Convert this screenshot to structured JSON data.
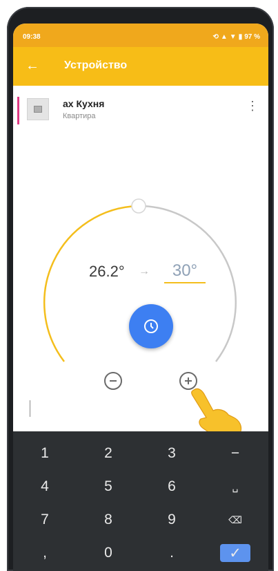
{
  "status_bar": {
    "time": "09:38",
    "battery": "97 %",
    "icons": [
      "sync-icon",
      "signal-icon",
      "wifi-icon",
      "battery-icon"
    ]
  },
  "app_bar": {
    "back_icon": "back-arrow-icon",
    "title": "Устройство"
  },
  "device": {
    "name": "ах Кухня",
    "location": "Квартира",
    "menu_icon": "more-vert-icon"
  },
  "thermostat": {
    "current_temperature": "26.2°",
    "arrow": "→",
    "target_temperature": "30°",
    "dial_level_fraction": 0.5,
    "clock_button_icon": "clock-icon",
    "decrease_icon": "minus-circle-icon",
    "increase_icon": "plus-circle-icon"
  },
  "keyboard": {
    "rows": [
      [
        "1",
        "2",
        "3",
        "−"
      ],
      [
        "4",
        "5",
        "6",
        "␣"
      ],
      [
        "7",
        "8",
        "9",
        "⌫"
      ],
      [
        ",",
        "0",
        ".",
        "✓"
      ]
    ]
  },
  "colors": {
    "accent": "#f7bd17",
    "status_bar": "#f0a81c",
    "primary_button": "#3d7ff2",
    "keyboard_bg": "#2d3033"
  }
}
